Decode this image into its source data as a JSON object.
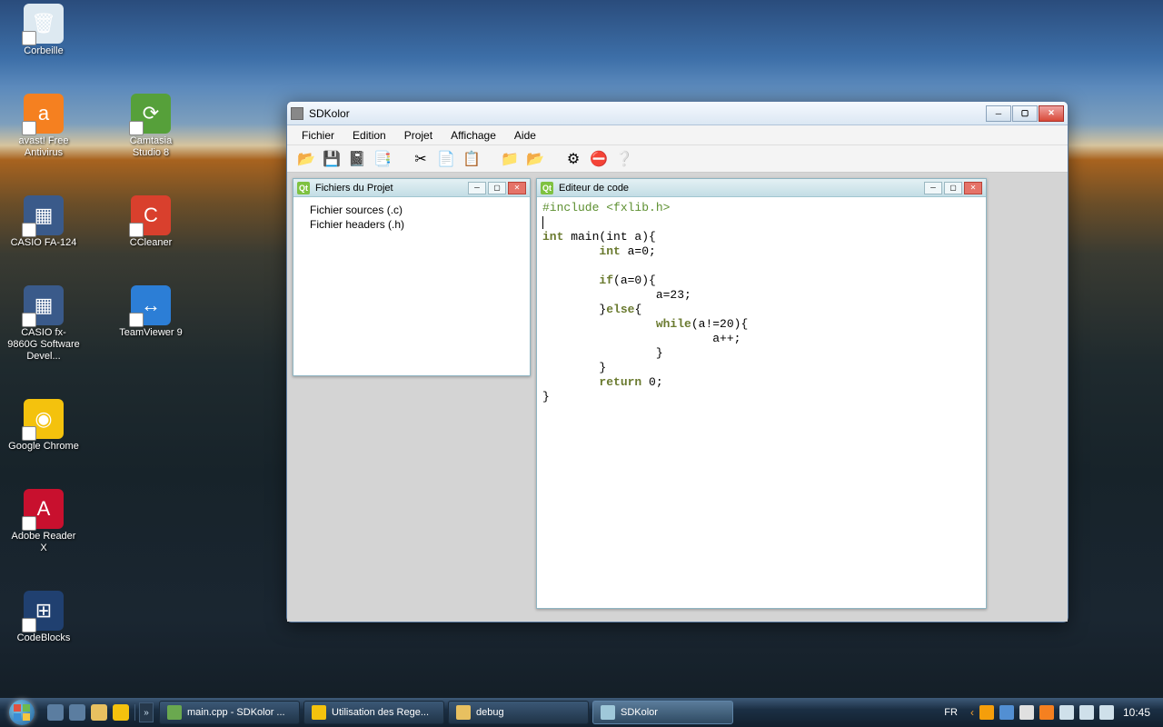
{
  "desktop": {
    "icons": [
      [
        {
          "name": "corbeille",
          "label": "Corbeille",
          "color": "#dde9f1",
          "emoji": "🗑"
        }
      ],
      [
        {
          "name": "avast",
          "label": "avast! Free Antivirus",
          "color": "#f58020",
          "emoji": "a"
        },
        {
          "name": "camtasia",
          "label": "Camtasia Studio 8",
          "color": "#56a03a",
          "emoji": "⟳"
        }
      ],
      [
        {
          "name": "casio-fa124",
          "label": "CASIO FA-124",
          "color": "#3a5a8a",
          "emoji": "▦"
        },
        {
          "name": "ccleaner",
          "label": "CCleaner",
          "color": "#d9402d",
          "emoji": "C"
        }
      ],
      [
        {
          "name": "casio-fx-sdk",
          "label": "CASIO fx-9860G Software Devel...",
          "color": "#3a5a8a",
          "emoji": "▦"
        },
        {
          "name": "teamviewer",
          "label": "TeamViewer 9",
          "color": "#2c7ed6",
          "emoji": "↔"
        }
      ],
      [
        {
          "name": "chrome",
          "label": "Google Chrome",
          "color": "#f4c20d",
          "emoji": "◉"
        }
      ],
      [
        {
          "name": "adobe-reader",
          "label": "Adobe Reader X",
          "color": "#c8102e",
          "emoji": "A"
        }
      ],
      [
        {
          "name": "codeblocks",
          "label": "CodeBlocks",
          "color": "#204070",
          "emoji": "⊞"
        }
      ]
    ]
  },
  "window": {
    "title": "SDKolor",
    "menu": [
      "Fichier",
      "Edition",
      "Projet",
      "Affichage",
      "Aide"
    ],
    "toolbar": [
      {
        "name": "open",
        "emoji": "📂",
        "tint": "#3d7bc4"
      },
      {
        "name": "save",
        "emoji": "💾",
        "tint": "#5a7db3"
      },
      {
        "name": "save-all",
        "emoji": "📓",
        "tint": "#7a5030"
      },
      {
        "name": "copy-doc",
        "emoji": "📑",
        "tint": "#7a5030"
      },
      {
        "name": "cut",
        "emoji": "✂",
        "tint": "#c08040"
      },
      {
        "name": "copy",
        "emoji": "📄",
        "tint": "#808080"
      },
      {
        "name": "paste",
        "emoji": "📋",
        "tint": "#caa040"
      },
      {
        "name": "new-folder",
        "emoji": "📁",
        "tint": "#d4a030"
      },
      {
        "name": "open-folder",
        "emoji": "📂",
        "tint": "#d4a030"
      },
      {
        "name": "settings",
        "emoji": "⚙",
        "tint": "#3a8bc8"
      },
      {
        "name": "stop",
        "emoji": "⛔",
        "tint": "#d43030"
      },
      {
        "name": "help",
        "emoji": "❔",
        "tint": "#3a8bc8"
      }
    ],
    "panels": {
      "project": {
        "title": "Fichiers du Projet",
        "items": [
          "Fichier sources (.c)",
          "Fichier headers (.h)"
        ]
      },
      "editor": {
        "title": "Editeur de code",
        "code": [
          {
            "t": "pp",
            "s": "#include <fxlib.h>"
          },
          {
            "t": "",
            "s": ""
          },
          {
            "t": "mix",
            "s": "int main(int a){",
            "kw": [
              "int"
            ]
          },
          {
            "t": "mix",
            "s": "        int a=0;",
            "kw": [
              "int"
            ]
          },
          {
            "t": "",
            "s": ""
          },
          {
            "t": "mix",
            "s": "        if(a=0){",
            "kw": [
              "if"
            ]
          },
          {
            "t": "",
            "s": "                a=23;"
          },
          {
            "t": "mix",
            "s": "        }else{",
            "kw": [
              "else"
            ]
          },
          {
            "t": "mix",
            "s": "                while(a!=20){",
            "kw": [
              "while"
            ]
          },
          {
            "t": "",
            "s": "                        a++;"
          },
          {
            "t": "",
            "s": "                }"
          },
          {
            "t": "",
            "s": "        }"
          },
          {
            "t": "mix",
            "s": "        return 0;",
            "kw": [
              "return"
            ]
          },
          {
            "t": "",
            "s": "}"
          }
        ]
      }
    }
  },
  "taskbar": {
    "quicklaunch": [
      {
        "name": "show-desktop",
        "color": "#5b7da0"
      },
      {
        "name": "switch",
        "color": "#5b7da0"
      },
      {
        "name": "explorer",
        "color": "#e8c060"
      },
      {
        "name": "chrome",
        "color": "#f4c20d"
      }
    ],
    "tasks": [
      {
        "name": "sdkolor-ide",
        "label": "main.cpp - SDKolor ...",
        "color": "#6aa84f"
      },
      {
        "name": "chrome-regex",
        "label": "Utilisation des Rege...",
        "color": "#f4c20d"
      },
      {
        "name": "explorer-debug",
        "label": "debug",
        "color": "#e8c060"
      },
      {
        "name": "sdkolor",
        "label": "SDKolor",
        "color": "#9fc8d9",
        "active": true
      }
    ],
    "lang": "FR",
    "tray": [
      {
        "name": "updates",
        "color": "#f59e0b"
      },
      {
        "name": "bluetooth",
        "color": "#528fd3"
      },
      {
        "name": "action",
        "color": "#e0e0e0"
      },
      {
        "name": "avast-tray",
        "color": "#f58020"
      },
      {
        "name": "network",
        "color": "#cfe0ea"
      },
      {
        "name": "battery",
        "color": "#cfe0ea"
      },
      {
        "name": "volume",
        "color": "#cfe0ea"
      }
    ],
    "clock": "10:45"
  }
}
